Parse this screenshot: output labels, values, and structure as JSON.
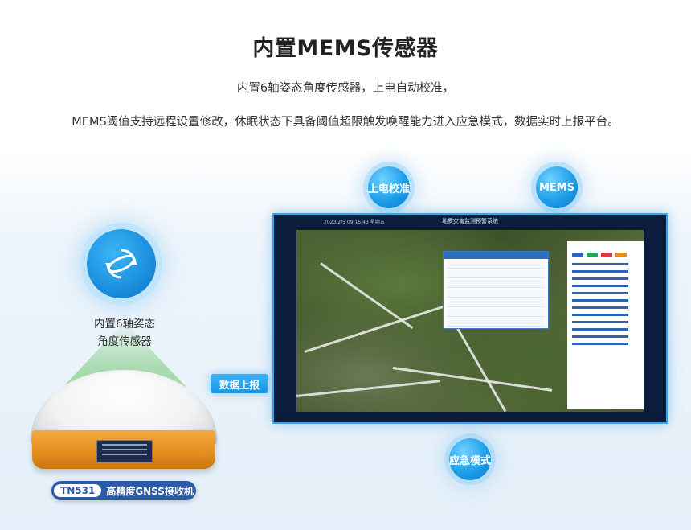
{
  "header": {
    "title": "内置MEMS传感器",
    "line1": "内置6轴姿态角度传感器，上电自动校准，",
    "line2": "MEMS阈值支持远程设置修改，休眠状态下具备阈值超限触发唤醒能力进入应急模式，数据实时上报平台。"
  },
  "bubbles": {
    "calibrate": "上电校准",
    "mems": "MEMS",
    "emergency": "应急模式"
  },
  "sensor": {
    "label_line1": "内置6轴姿态",
    "label_line2": "角度传感器"
  },
  "upload_label": "数据上报",
  "device": {
    "model": "TN531",
    "name": "高精度GNSS接收机"
  },
  "monitor": {
    "system_title": "地质灾害监测预警系统",
    "timestamp": "2023/2/5 09:15:43 星期五"
  },
  "colors": {
    "accent": "#1f9fe9",
    "device_orange": "#e58e1e",
    "tag_blue": "#2d5aa5"
  }
}
